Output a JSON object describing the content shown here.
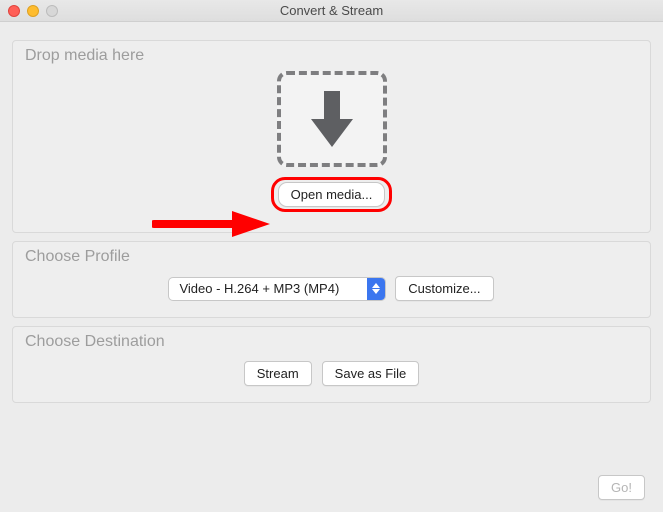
{
  "window": {
    "title": "Convert & Stream"
  },
  "drop": {
    "legend": "Drop media here",
    "open_media_label": "Open media..."
  },
  "profile": {
    "legend": "Choose Profile",
    "selected": "Video - H.264 + MP3 (MP4)",
    "customize_label": "Customize..."
  },
  "destination": {
    "legend": "Choose Destination",
    "stream_label": "Stream",
    "save_as_file_label": "Save as File"
  },
  "footer": {
    "go_label": "Go!"
  }
}
